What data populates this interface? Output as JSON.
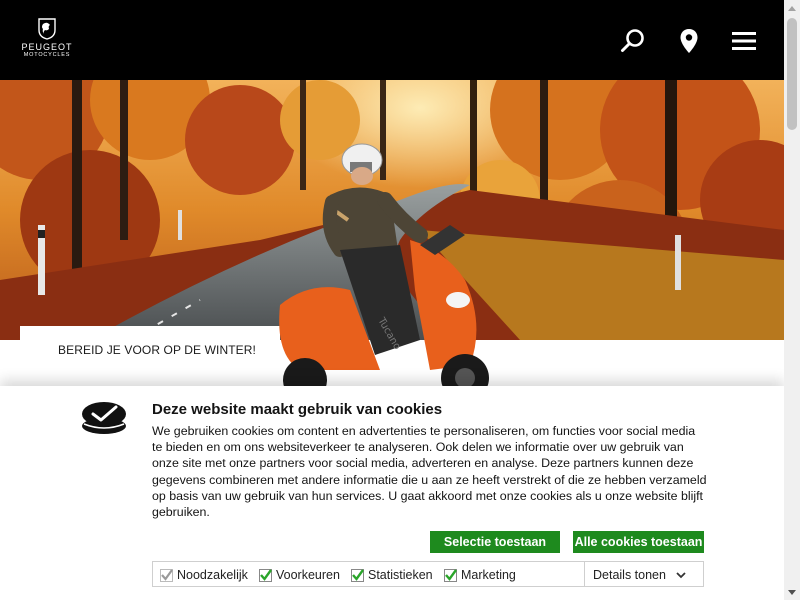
{
  "header": {
    "logo_brand": "PEUGEOT",
    "logo_sub": "MOTOCYCLES",
    "icons": [
      "search-icon",
      "location-pin-icon",
      "hamburger-menu-icon"
    ]
  },
  "hero": {
    "promo_text": "BEREID JE VOOR OP DE WINTER!"
  },
  "cookie_banner": {
    "title": "Deze website maakt gebruik van cookies",
    "body": "We gebruiken cookies om content en advertenties te personaliseren, om functies voor social media te bieden en om ons websiteverkeer te analyseren. Ook delen we informatie over uw gebruik van onze site met onze partners voor social media, adverteren en analyse. Deze partners kunnen deze gegevens combineren met andere informatie die u aan ze heeft verstrekt of die ze hebben verzameld op basis van uw gebruik van hun services. U gaat akkoord met onze cookies als u onze website blijft gebruiken.",
    "button_selection": "Selectie toestaan",
    "button_all": "Alle cookies toestaan",
    "checkboxes": [
      {
        "label": "Noodzakelijk",
        "checked": true,
        "disabled": true
      },
      {
        "label": "Voorkeuren",
        "checked": true,
        "disabled": false
      },
      {
        "label": "Statistieken",
        "checked": true,
        "disabled": false
      },
      {
        "label": "Marketing",
        "checked": true,
        "disabled": false
      }
    ],
    "details_label": "Details tonen"
  },
  "colors": {
    "header_bg": "#000000",
    "accept_green": "#1e8a1e",
    "check_green": "#2aa52a",
    "scooter_orange": "#e8601c"
  }
}
